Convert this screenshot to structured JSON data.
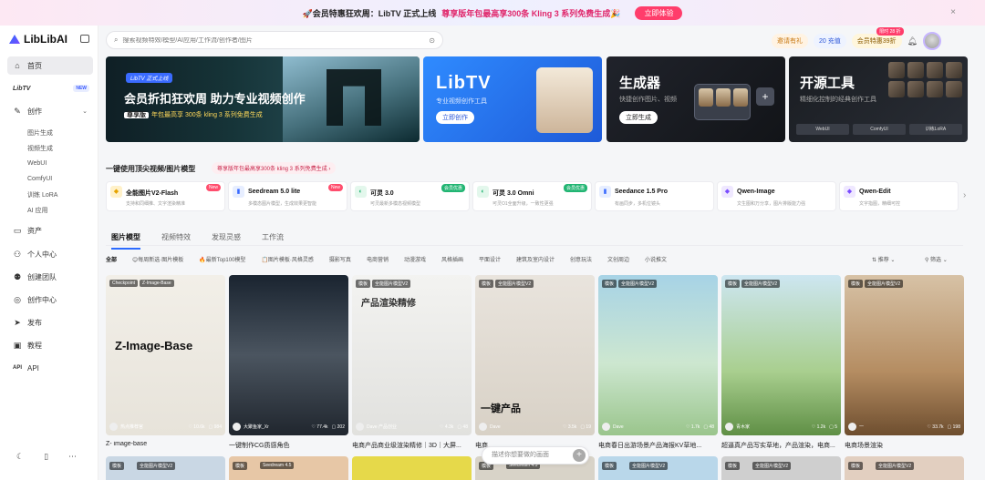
{
  "promo": {
    "lead": "🚀会员特惠狂欢周：LibTV 正式上线",
    "highlight": "尊享版年包最高享300条 Kling 3 系列免费生成🎉",
    "cta": "立即体验",
    "close": "×"
  },
  "sidebar": {
    "brand": "LibLibAI",
    "items": [
      {
        "label": "首页",
        "icon": "home-icon"
      },
      {
        "label": "LibTV",
        "badge": "NEW"
      },
      {
        "label": "创作",
        "icon": "create-icon"
      },
      {
        "label": "资产",
        "icon": "folder-icon"
      },
      {
        "label": "个人中心",
        "icon": "user-icon"
      },
      {
        "label": "创建团队",
        "icon": "team-icon"
      },
      {
        "label": "创作中心",
        "icon": "studio-icon"
      },
      {
        "label": "发布",
        "icon": "publish-icon"
      },
      {
        "label": "教程",
        "icon": "book-icon"
      },
      {
        "label": "API",
        "icon": "api-icon"
      }
    ],
    "sub_items": [
      "图片生成",
      "视频生成",
      "WebUI",
      "ComfyUI",
      "训练 LoRA",
      "AI 应用"
    ]
  },
  "header": {
    "search_placeholder": "搜索视频特效/模型/AI应用/工作流/创作者/图片",
    "invite": "邀请有礼",
    "credits": "20 充值",
    "vip": "会员特惠39折",
    "vip_tag": "限时 28 折"
  },
  "heroes": {
    "h1_pill": "LibTV 正式上线",
    "h1_title": "会员折扣狂欢周 助力专业视频创作",
    "h1_badge": "尊享版",
    "h1_sub": "年包最高享 300条 kling 3 系列免费生成",
    "h2_title": "LibTV",
    "h2_sub": "专业视频创作工具",
    "h2_btn": "立即创作",
    "h3_title": "生成器",
    "h3_sub": "快捷创作图片、视频",
    "h3_btn": "立即生成",
    "h4_title": "开源工具",
    "h4_sub": "精细化控制的经典创作工具",
    "h4_chips": [
      "WebUI",
      "ComfyUI",
      "训练LoRA"
    ]
  },
  "models": {
    "title": "一键使用顶尖视频/图片模型",
    "promo": "尊享版年包最高享300条 kling 3 系列免费生成 ›",
    "items": [
      {
        "name": "全能图片V2-Flash",
        "desc": "支持和同细推、文字渲染精准",
        "tag": "New",
        "tag_color": "#ff4d6d",
        "ic": "◆",
        "ic_bg": "#fff1c9",
        "ic_color": "#e6a400"
      },
      {
        "name": "Seedream 5.0 lite",
        "desc": "多模态图片模型，生成效果更智能",
        "tag": "New",
        "tag_color": "#ff4d6d",
        "ic": "▮",
        "ic_bg": "#e7eeff",
        "ic_color": "#3a6bff"
      },
      {
        "name": "可灵 3.0",
        "desc": "可灵最新多模态视频模型",
        "tag": "会员优惠",
        "tag_color": "#22b573",
        "ic": "◐",
        "ic_bg": "#e3f7ec",
        "ic_color": "#22b573"
      },
      {
        "name": "可灵 3.0 Omni",
        "desc": "可灵O1全面升级，一致性更强",
        "tag": "会员优惠",
        "tag_color": "#22b573",
        "ic": "◐",
        "ic_bg": "#e3f7ec",
        "ic_color": "#22b573"
      },
      {
        "name": "Seedance 1.5 Pro",
        "desc": "有画同步，多机位镜头",
        "tag": "",
        "tag_color": "",
        "ic": "▮",
        "ic_bg": "#e7eeff",
        "ic_color": "#3a6bff"
      },
      {
        "name": "Qwen-Image",
        "desc": "文生图和万分享，图片排版能力强",
        "tag": "",
        "tag_color": "",
        "ic": "◆",
        "ic_bg": "#efe8ff",
        "ic_color": "#7a4bff"
      },
      {
        "name": "Qwen-Edit",
        "desc": "文字指图，精细可控",
        "tag": "",
        "tag_color": "",
        "ic": "◆",
        "ic_bg": "#efe8ff",
        "ic_color": "#7a4bff"
      }
    ]
  },
  "tabs": [
    "图片模型",
    "视频特效",
    "发现灵感",
    "工作流"
  ],
  "filters": [
    "全部",
    "😊每周新选·图片模板",
    "🔥最新Top100模型",
    "📋图片模板·风格灵感",
    "摄影写真",
    "电商营销",
    "动漫游戏",
    "风格插画",
    "平面设计",
    "建筑及室内设计",
    "创意玩法",
    "文创周边",
    "小说推文"
  ],
  "sort": "⇅ 推荐 ⌄",
  "filter_btn": "⚲ 筛选 ⌄",
  "cards": [
    {
      "chips": [
        "Checkpoint",
        "Z-Image-Base"
      ],
      "big": "Z-Image-Base",
      "author": "热点推荐官",
      "likes": "♡ 10.6k",
      "imgs": "▢ 984",
      "caption": "Z- image-base",
      "bg": "linear-gradient(180deg,#f2efe8,#e7e3da)"
    },
    {
      "chips": [],
      "big": "",
      "author": "大聚鱼家_Xr",
      "likes": "♡ 77.4k",
      "imgs": "▢ 202",
      "caption": "一键制作CG质感角色",
      "bg": "linear-gradient(180deg,#1a2430,#4b5560 50%,#20262e)"
    },
    {
      "chips": [
        "模板",
        "全能图片模型V2"
      ],
      "big": "产品渲染精修",
      "author": "Dave 产品创业",
      "likes": "♡ 4.3k",
      "imgs": "▢ 48",
      "caption": "电商产品商业级渲染精修｜3D｜大屏...",
      "bg": "linear-gradient(180deg,#f3f3f1,#e1e1de)"
    },
    {
      "chips": [
        "模板",
        "全能图片模型V2"
      ],
      "big": "一键产品",
      "author": "Dave",
      "likes": "♡ 3.5k",
      "imgs": "▢ 19",
      "caption": "电商...",
      "bg": "linear-gradient(180deg,#e9e4dd,#d8d1c6)"
    },
    {
      "chips": [
        "模板",
        "全能图片模型V2"
      ],
      "big": "",
      "author": "Dave",
      "likes": "♡ 1.7k",
      "imgs": "▢ 48",
      "caption": "电商春日出游场景产品海报KV草地...",
      "bg": "linear-gradient(180deg,#a7d3e6,#cde7d0 55%,#9ac58c)"
    },
    {
      "chips": [
        "模板",
        "全能图片模型V2"
      ],
      "big": "",
      "author": "青木家",
      "likes": "♡ 1.2k",
      "imgs": "▢ 5",
      "caption": "超逼真产品写实草地，产品渲染，电商...",
      "bg": "linear-gradient(180deg,#cde6f1,#a9cf8f 60%,#5f8f45)"
    },
    {
      "chips": [
        "模板",
        "全能图片模型V2"
      ],
      "big": "",
      "author": "一",
      "likes": "♡ 33.7k",
      "imgs": "▢ 198",
      "caption": "电商场景渲染",
      "bg": "linear-gradient(180deg,#d7c2a6,#b58d62 60%,#6e4e2f)"
    }
  ],
  "bottom_strip": [
    {
      "a": "模板",
      "b": "全能图片模型V2",
      "bg": "#c9d7e4"
    },
    {
      "a": "模板",
      "b": "Seedream 4.5",
      "bg": "#e7c7a6"
    },
    {
      "a": "",
      "b": "",
      "bg": "#e6d94a"
    },
    {
      "a": "模板",
      "b": "Seedream 4.5",
      "bg": "#d8d3c8"
    },
    {
      "a": "模板",
      "b": "全能图片模型V2",
      "bg": "#b9d7ea"
    },
    {
      "a": "模板",
      "b": "全能图片模型V2",
      "bg": "#cfcfcf"
    },
    {
      "a": "模板",
      "b": "全能图片模型V2",
      "bg": "#e2cfc0"
    }
  ],
  "ask": {
    "placeholder": "描述你想要做的画面",
    "plus": "+"
  }
}
